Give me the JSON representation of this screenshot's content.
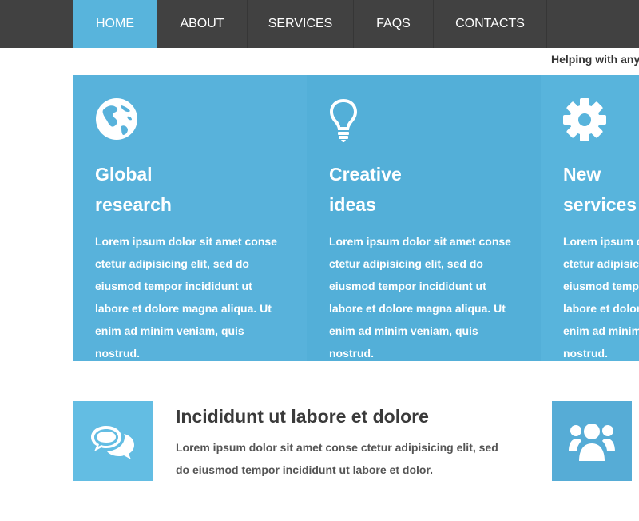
{
  "nav": {
    "items": [
      {
        "label": "HOME"
      },
      {
        "label": "ABOUT"
      },
      {
        "label": "SERVICES"
      },
      {
        "label": "FAQS"
      },
      {
        "label": "CONTACTS"
      }
    ]
  },
  "tagline": "Helping with any qu",
  "features": [
    {
      "icon": "globe-icon",
      "title_line1": "Global",
      "title_line2": "research",
      "text": "Lorem ipsum dolor sit amet conse ctetur adipisicing elit, sed do eiusmod tempor incididunt ut labore et dolore magna aliqua. Ut enim ad minim veniam, quis nostrud.",
      "color": "#58b2db"
    },
    {
      "icon": "lightbulb-icon",
      "title_line1": "Creative",
      "title_line2": "ideas",
      "text": "Lorem ipsum dolor sit amet conse ctetur adipisicing elit, sed do eiusmod tempor incididunt ut labore et dolore magna aliqua. Ut enim ad minim veniam, quis nostrud.",
      "color": "#53afd8"
    },
    {
      "icon": "gear-icon",
      "title_line1": "New",
      "title_line2": "services",
      "text": "Lorem ipsum dolor sit amet conse ctetur adipisicing elit, sed do eiusmod tempor incididunt ut labore et dolore magna aliqua. Ut enim ad minim veniam, quis nostrud.",
      "color": "#58b4dc"
    }
  ],
  "bottom": {
    "left_icon": "chat-bubbles-icon",
    "right_icon": "users-group-icon",
    "title": "Incididunt ut labore et dolore",
    "text": "Lorem ipsum dolor sit amet conse ctetur adipisicing elit, sed do eiusmod tempor incididunt ut labore et dolor.",
    "icon_color": "#63bde3",
    "right_icon_color": "#56acd6"
  },
  "colors": {
    "nav_bg": "#414141",
    "nav_active": "#58b4dc"
  }
}
